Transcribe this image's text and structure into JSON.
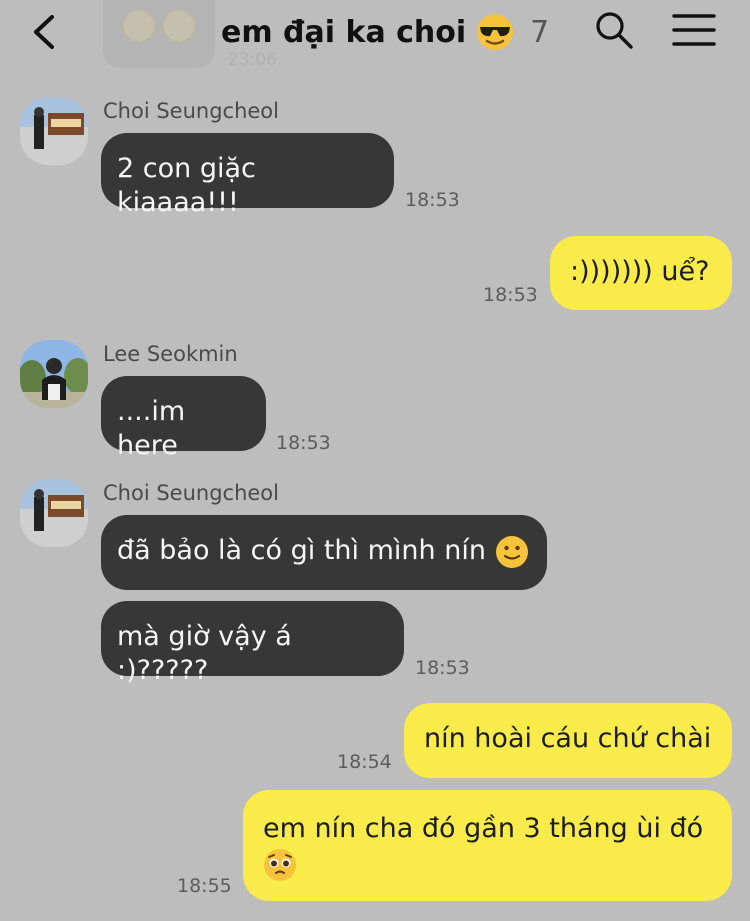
{
  "header": {
    "title": "em đại ka choi",
    "member_count": "7",
    "icons": [
      "back-icon",
      "sunglasses-emoji-icon",
      "search-icon",
      "menu-icon"
    ]
  },
  "faded": {
    "time": "23:06"
  },
  "messages": [
    {
      "sender": "Choi Seungcheol",
      "text": "2 con giặc kiaaaa!!!",
      "time": "18:53",
      "side": "left"
    },
    {
      "sender": "",
      "text": ":))))))) uể?",
      "time": "18:53",
      "side": "right"
    },
    {
      "sender": "Lee Seokmin",
      "text": "....im here",
      "time": "18:53",
      "side": "left"
    },
    {
      "sender": "Choi Seungcheol",
      "text": "đã bảo là có gì thì mình nín",
      "time": "",
      "side": "left"
    },
    {
      "sender": "",
      "text": "mà giờ vậy á :)?????",
      "time": "18:53",
      "side": "left"
    },
    {
      "sender": "",
      "text": "nín hoài cáu chứ chài",
      "time": "18:54",
      "side": "right"
    },
    {
      "sender": "",
      "text": "em nín cha đó gần 3 tháng ùi đó",
      "time": "18:55",
      "side": "right"
    }
  ],
  "colors": {
    "background": "#bdbdbd",
    "bubble_dark": "#373737",
    "bubble_yellow": "#f9eb4a"
  }
}
